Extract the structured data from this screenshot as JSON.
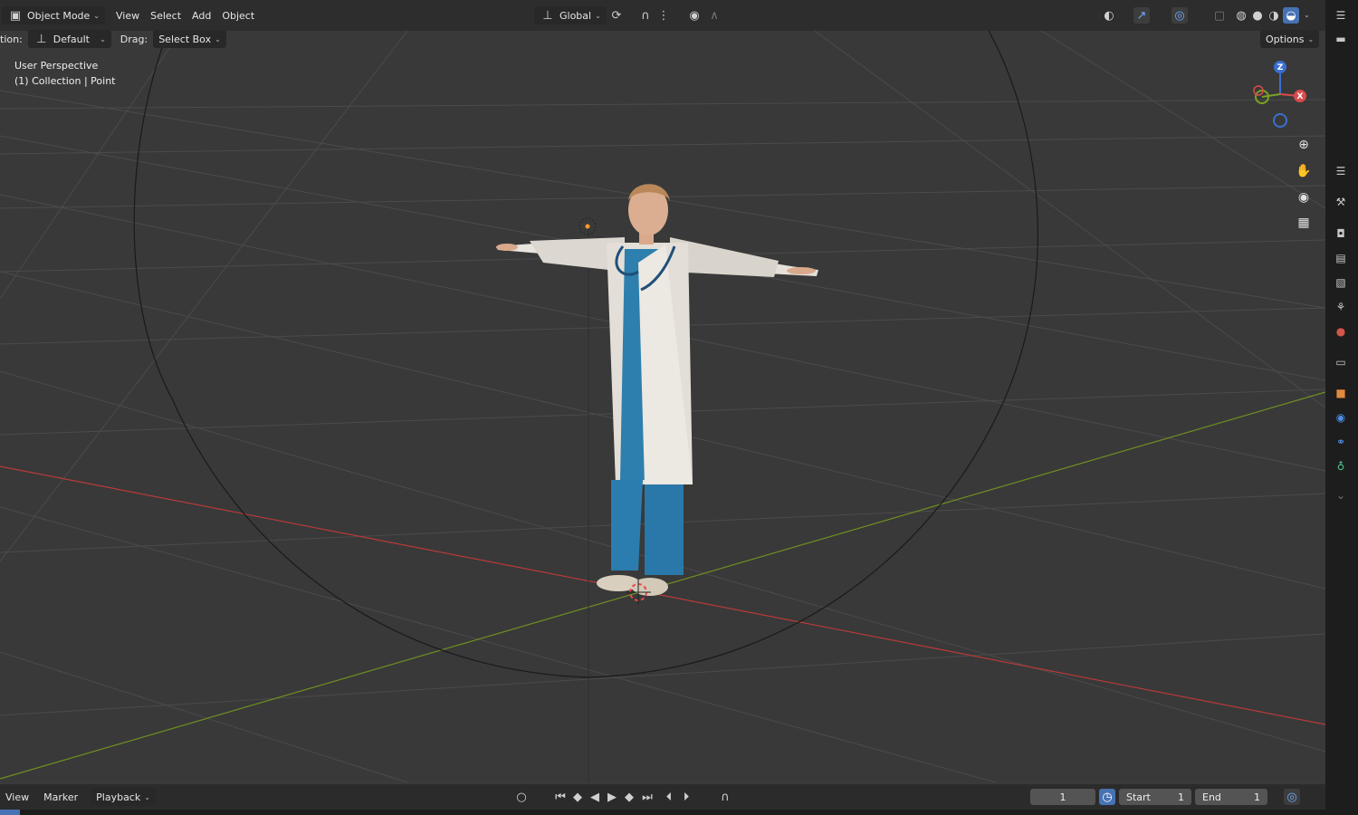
{
  "header": {
    "mode": "Object Mode",
    "menus": [
      "View",
      "Select",
      "Add",
      "Object"
    ],
    "orientation": "Global",
    "options": "Options"
  },
  "tool_options": {
    "orientation_label": "tion:",
    "orientation_value": "Default",
    "drag_label": "Drag:",
    "drag_value": "Select Box"
  },
  "viewport": {
    "view_name": "User Perspective",
    "collection_info": "(1) Collection | Point",
    "gizmo_axes": [
      "Z",
      "X"
    ]
  },
  "timeline": {
    "menus": [
      "View",
      "Marker"
    ],
    "playback": "Playback",
    "current_frame": "1",
    "start_label": "Start",
    "start_value": "1",
    "end_label": "End",
    "end_value": "1"
  },
  "colors": {
    "x_axis": "#c43a3a",
    "y_axis": "#7a9a2a",
    "grid": "#4a4a4a",
    "background": "#3a3a3a",
    "accent": "#4772b3"
  },
  "icons": {
    "mode": "object-mode-icon",
    "zoom": "zoom-icon",
    "pan": "hand-pan-icon",
    "camera": "camera-view-icon",
    "ortho": "grid-ortho-icon"
  }
}
